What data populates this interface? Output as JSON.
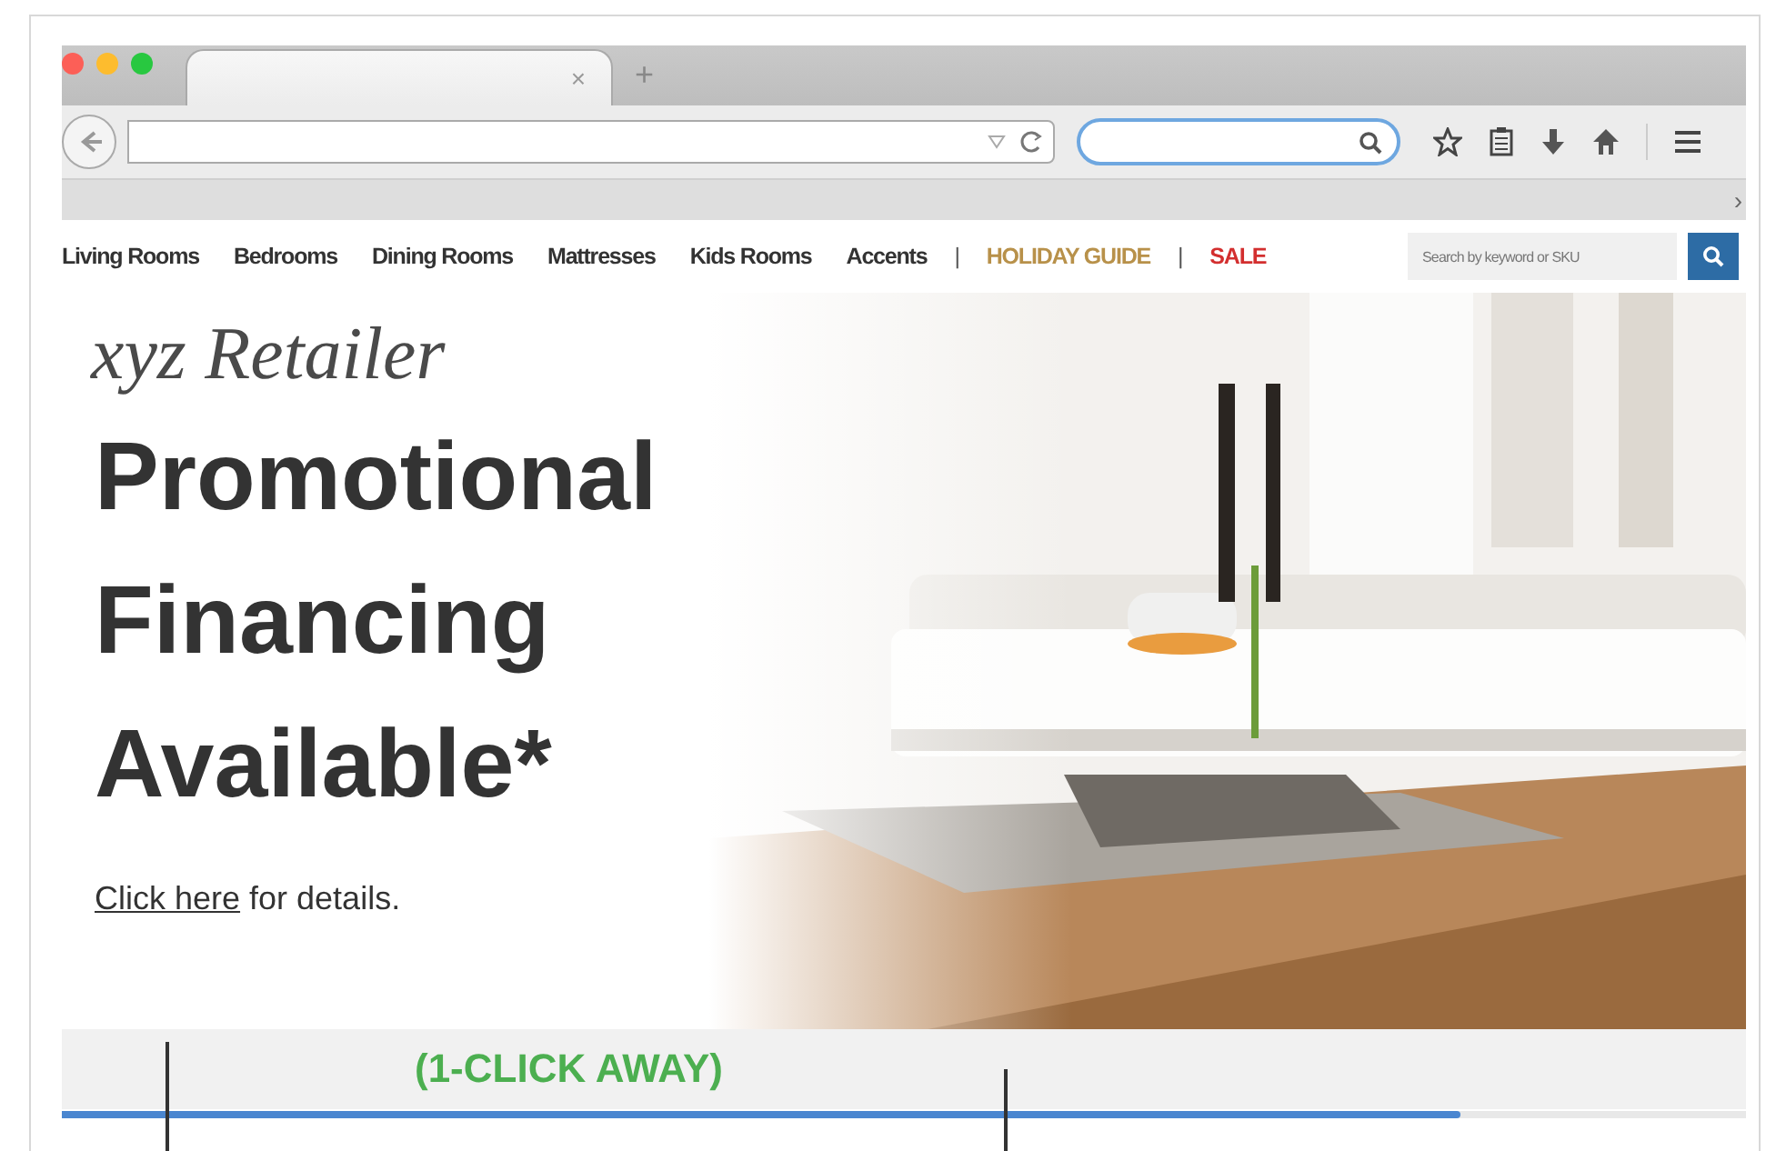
{
  "browser": {
    "tab": {
      "close": "×"
    },
    "new_tab": "+",
    "overflow": "›"
  },
  "nav": {
    "items": [
      {
        "label": "Living Rooms",
        "kind": "plain"
      },
      {
        "label": "Bedrooms",
        "kind": "plain"
      },
      {
        "label": "Dining Rooms",
        "kind": "plain"
      },
      {
        "label": "Mattresses",
        "kind": "plain"
      },
      {
        "label": "Kids Rooms",
        "kind": "plain"
      },
      {
        "label": "Accents",
        "kind": "plain"
      },
      {
        "label": "|",
        "kind": "separator"
      },
      {
        "label": "HOLIDAY GUIDE",
        "kind": "highlight",
        "color": "#b8914a"
      },
      {
        "label": "|",
        "kind": "separator"
      },
      {
        "label": "SALE",
        "kind": "highlight",
        "color": "#d32f2f"
      }
    ],
    "search": {
      "placeholder": "Search by keyword or SKU"
    }
  },
  "hero": {
    "logo": "xyz Retailer",
    "headline": [
      "Promotional",
      "Financing",
      "Available*"
    ],
    "link": "Click here",
    "after_link": " for details."
  },
  "strip": {
    "text": "(1-CLICK AWAY)",
    "progress": {
      "level": 0.83
    }
  }
}
